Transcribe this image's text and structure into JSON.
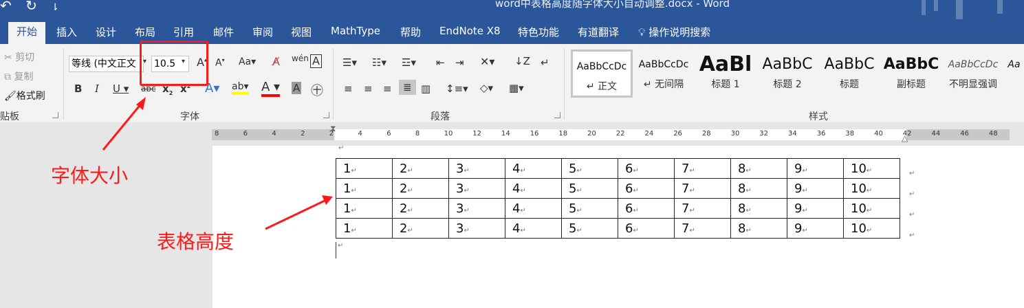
{
  "window": {
    "title": "word中表格高度随字体大小自动调整.docx  -  Word"
  },
  "quick_access": {
    "undo_icon": "↶",
    "redo_icon": "↻",
    "customize_icon": "⇂"
  },
  "tabs": [
    "开始",
    "插入",
    "设计",
    "布局",
    "引用",
    "邮件",
    "审阅",
    "视图",
    "MathType",
    "帮助",
    "EndNote X8",
    "特色功能",
    "有道翻译"
  ],
  "tell_me": "操作说明搜索",
  "clipboard": {
    "label": "贴板",
    "cut": "剪切",
    "copy": "复制",
    "format_painter": "格式刷"
  },
  "font": {
    "label": "字体",
    "name": "等线 (中文正文",
    "size": "10.5"
  },
  "paragraph": {
    "label": "段落"
  },
  "styles": {
    "label": "样式",
    "items": [
      {
        "sample": "AaBbCcDc",
        "name": "↵ 正文"
      },
      {
        "sample": "AaBbCcDc",
        "name": "↵ 无间隔"
      },
      {
        "sample": "AaBl",
        "name": "标题 1"
      },
      {
        "sample": "AaBbC",
        "name": "标题 2"
      },
      {
        "sample": "AaBbC",
        "name": "标题"
      },
      {
        "sample": "AaBbC",
        "name": "副标题"
      },
      {
        "sample": "AaBbCcDc",
        "name": "不明显强调"
      },
      {
        "sample": "Aa",
        "name": ""
      }
    ]
  },
  "ruler_numbers": [
    "8",
    "6",
    "4",
    "2",
    "2",
    "4",
    "6",
    "8",
    "10",
    "12",
    "14",
    "16",
    "18",
    "20",
    "22",
    "24",
    "26",
    "28",
    "30",
    "32",
    "34",
    "36",
    "38",
    "40",
    "42",
    "44",
    "46",
    "48"
  ],
  "table": {
    "rows": [
      [
        "1",
        "2",
        "3",
        "4",
        "5",
        "6",
        "7",
        "8",
        "9",
        "10"
      ],
      [
        "1",
        "2",
        "3",
        "4",
        "5",
        "6",
        "7",
        "8",
        "9",
        "10"
      ],
      [
        "1",
        "2",
        "3",
        "4",
        "5",
        "6",
        "7",
        "8",
        "9",
        "10"
      ],
      [
        "1",
        "2",
        "3",
        "4",
        "5",
        "6",
        "7",
        "8",
        "9",
        "10"
      ]
    ]
  },
  "annotations": {
    "font_size": "字体大小",
    "table_height": "表格高度"
  },
  "colors": {
    "ribbon_blue": "#2b579a",
    "annotation_red": "#ff1a1a"
  }
}
